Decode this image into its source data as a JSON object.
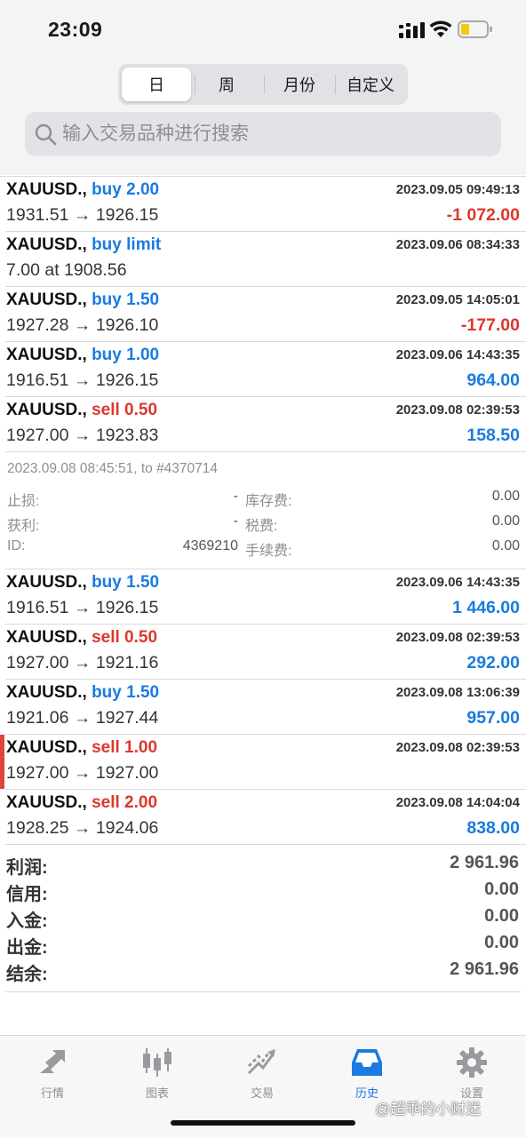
{
  "status_bar": {
    "time": "23:09"
  },
  "segments": [
    {
      "label": "日",
      "active": true
    },
    {
      "label": "周",
      "active": false
    },
    {
      "label": "月份",
      "active": false
    },
    {
      "label": "自定义",
      "active": false
    }
  ],
  "search": {
    "placeholder": "输入交易品种进行搜索"
  },
  "deals": [
    {
      "symbol": "XAUUSD.,",
      "action": "buy 2.00",
      "side": "buy",
      "datetime": "2023.09.05 09:49:13",
      "prices": "1931.51 → 1926.15",
      "profit": "-1 072.00",
      "profit_color": "red"
    },
    {
      "symbol": "XAUUSD.,",
      "action": "buy limit",
      "side": "buy",
      "datetime": "2023.09.06 08:34:33",
      "prices": "7.00 at 1908.56",
      "profit": "",
      "profit_color": "blue"
    },
    {
      "symbol": "XAUUSD.,",
      "action": "buy 1.50",
      "side": "buy",
      "datetime": "2023.09.05 14:05:01",
      "prices": "1927.28 → 1926.10",
      "profit": "-177.00",
      "profit_color": "red"
    },
    {
      "symbol": "XAUUSD.,",
      "action": "buy 1.00",
      "side": "buy",
      "datetime": "2023.09.06 14:43:35",
      "prices": "1916.51 → 1926.15",
      "profit": "964.00",
      "profit_color": "blue"
    },
    {
      "symbol": "XAUUSD.,",
      "action": "sell 0.50",
      "side": "sell",
      "datetime": "2023.09.08 02:39:53",
      "prices": "1927.00 → 1923.83",
      "profit": "158.50",
      "profit_color": "blue"
    }
  ],
  "details": {
    "header": "2023.09.08 08:45:51, to #4370714",
    "stop_loss_label": "止损:",
    "stop_loss_value": "-",
    "take_profit_label": "获利:",
    "take_profit_value": "-",
    "id_label": "ID:",
    "id_value": "4369210",
    "swap_label": "库存费:",
    "swap_value": "0.00",
    "tax_label": "税费:",
    "tax_value": "0.00",
    "commission_label": "手续费:",
    "commission_value": "0.00"
  },
  "deals2": [
    {
      "symbol": "XAUUSD.,",
      "action": "buy 1.50",
      "side": "buy",
      "datetime": "2023.09.06 14:43:35",
      "prices": "1916.51 → 1926.15",
      "profit": "1 446.00",
      "profit_color": "blue",
      "marked": false
    },
    {
      "symbol": "XAUUSD.,",
      "action": "sell 0.50",
      "side": "sell",
      "datetime": "2023.09.08 02:39:53",
      "prices": "1927.00 → 1921.16",
      "profit": "292.00",
      "profit_color": "blue",
      "marked": false
    },
    {
      "symbol": "XAUUSD.,",
      "action": "buy 1.50",
      "side": "buy",
      "datetime": "2023.09.08 13:06:39",
      "prices": "1921.06 → 1927.44",
      "profit": "957.00",
      "profit_color": "blue",
      "marked": false
    },
    {
      "symbol": "XAUUSD.,",
      "action": "sell 1.00",
      "side": "sell",
      "datetime": "2023.09.08 02:39:53",
      "prices": "1927.00 → 1927.00",
      "profit": "",
      "profit_color": "blue",
      "marked": true
    },
    {
      "symbol": "XAUUSD.,",
      "action": "sell 2.00",
      "side": "sell",
      "datetime": "2023.09.08 14:04:04",
      "prices": "1928.25 → 1924.06",
      "profit": "838.00",
      "profit_color": "blue",
      "marked": false
    }
  ],
  "summary": [
    {
      "label": "利润:",
      "value": "2 961.96"
    },
    {
      "label": "信用:",
      "value": "0.00"
    },
    {
      "label": "入金:",
      "value": "0.00"
    },
    {
      "label": "出金:",
      "value": "0.00"
    },
    {
      "label": "结余:",
      "value": "2 961.96"
    }
  ],
  "tabs": [
    {
      "label": "行情",
      "icon": "quotes-icon",
      "active": false
    },
    {
      "label": "图表",
      "icon": "candlestick-icon",
      "active": false
    },
    {
      "label": "交易",
      "icon": "trade-icon",
      "active": false
    },
    {
      "label": "历史",
      "icon": "history-inbox-icon",
      "active": true
    },
    {
      "label": "设置",
      "icon": "gear-icon",
      "active": false
    }
  ],
  "watermark": "@超乖的小财迷",
  "colors": {
    "buy": "#1a7be0",
    "sell": "#e0362c",
    "active_tab": "#1a7be0"
  }
}
